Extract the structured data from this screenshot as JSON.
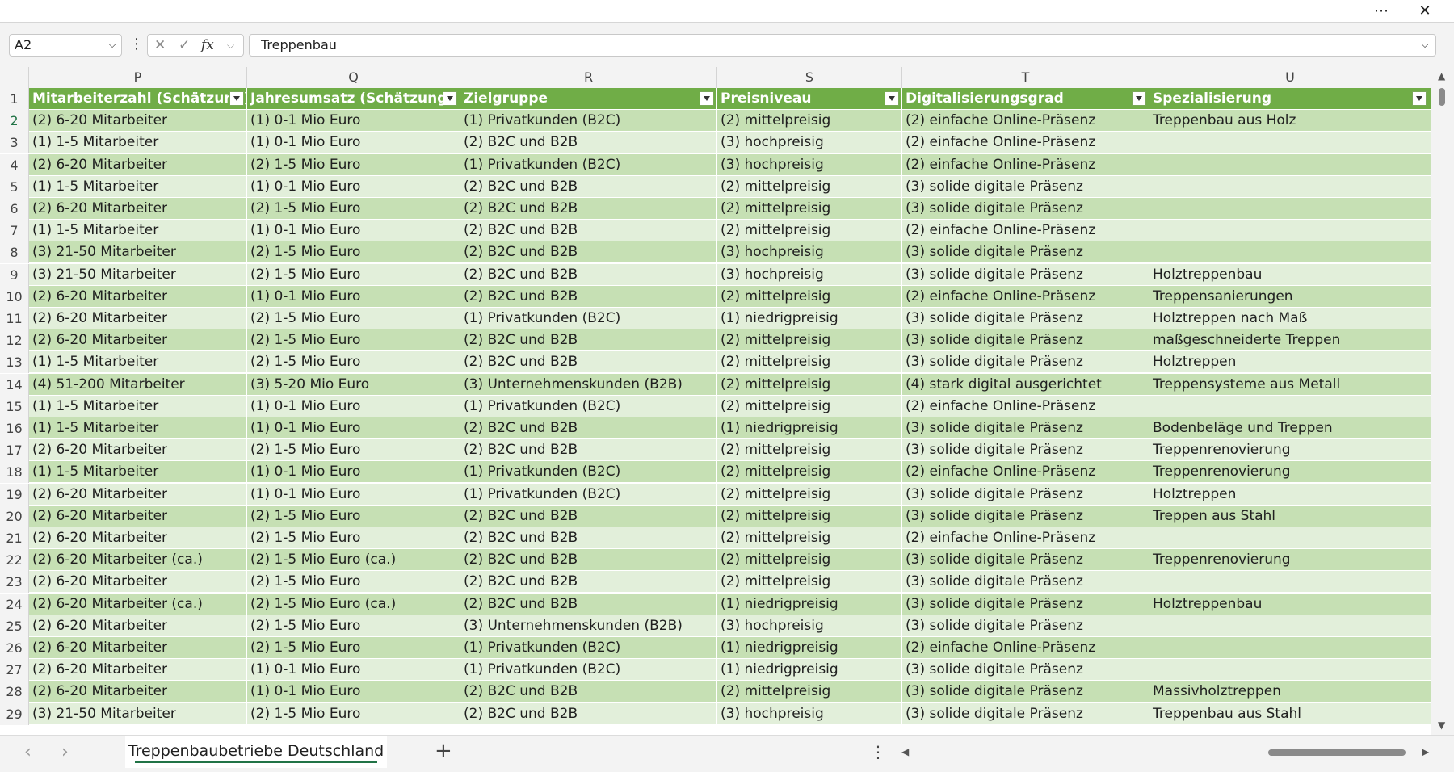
{
  "titlebar": {
    "more_icon": "ellipsis-icon",
    "close_icon": "close-icon"
  },
  "formula_bar": {
    "name_box": "A2",
    "formula": "Treppenbau"
  },
  "columns": [
    {
      "letter": "P",
      "header": "Mitarbeiterzahl (Schätzung)"
    },
    {
      "letter": "Q",
      "header": "Jahresumsatz (Schätzung)"
    },
    {
      "letter": "R",
      "header": "Zielgruppe"
    },
    {
      "letter": "S",
      "header": "Preisniveau"
    },
    {
      "letter": "T",
      "header": "Digitalisierungsgrad"
    },
    {
      "letter": "U",
      "header": "Spezialisierung"
    }
  ],
  "rows": [
    {
      "num": "2",
      "cells": [
        "(2) 6-20 Mitarbeiter",
        "(1) 0-1 Mio Euro",
        "(1) Privatkunden (B2C)",
        "(2) mittelpreisig",
        "(2) einfache Online-Präsenz",
        "Treppenbau aus Holz"
      ]
    },
    {
      "num": "3",
      "cells": [
        "(1) 1-5 Mitarbeiter",
        "(1) 0-1 Mio Euro",
        "(2) B2C und B2B",
        "(3) hochpreisig",
        "(2) einfache Online-Präsenz",
        ""
      ]
    },
    {
      "num": "4",
      "cells": [
        "(2) 6-20 Mitarbeiter",
        "(2) 1-5 Mio Euro",
        "(1) Privatkunden (B2C)",
        "(3) hochpreisig",
        "(2) einfache Online-Präsenz",
        ""
      ]
    },
    {
      "num": "5",
      "cells": [
        "(1) 1-5 Mitarbeiter",
        "(1) 0-1 Mio Euro",
        "(2) B2C und B2B",
        "(2) mittelpreisig",
        "(3) solide digitale Präsenz",
        ""
      ]
    },
    {
      "num": "6",
      "cells": [
        "(2) 6-20 Mitarbeiter",
        "(2) 1-5 Mio Euro",
        "(2) B2C und B2B",
        "(2) mittelpreisig",
        "(3) solide digitale Präsenz",
        ""
      ]
    },
    {
      "num": "7",
      "cells": [
        "(1) 1-5 Mitarbeiter",
        "(1) 0-1 Mio Euro",
        "(2) B2C und B2B",
        "(2) mittelpreisig",
        "(2) einfache Online-Präsenz",
        ""
      ]
    },
    {
      "num": "8",
      "cells": [
        "(3) 21-50 Mitarbeiter",
        "(2) 1-5 Mio Euro",
        "(2) B2C und B2B",
        "(3) hochpreisig",
        "(3) solide digitale Präsenz",
        ""
      ]
    },
    {
      "num": "9",
      "cells": [
        "(3) 21-50 Mitarbeiter",
        "(2) 1-5 Mio Euro",
        "(2) B2C und B2B",
        "(3) hochpreisig",
        "(3) solide digitale Präsenz",
        "Holztreppenbau"
      ]
    },
    {
      "num": "10",
      "cells": [
        "(2) 6-20 Mitarbeiter",
        "(1) 0-1 Mio Euro",
        "(2) B2C und B2B",
        "(2) mittelpreisig",
        "(2) einfache Online-Präsenz",
        "Treppensanierungen"
      ]
    },
    {
      "num": "11",
      "cells": [
        "(2) 6-20 Mitarbeiter",
        "(2) 1-5 Mio Euro",
        "(1) Privatkunden (B2C)",
        "(1) niedrigpreisig",
        "(3) solide digitale Präsenz",
        "Holztreppen nach Maß"
      ]
    },
    {
      "num": "12",
      "cells": [
        "(2) 6-20 Mitarbeiter",
        "(2) 1-5 Mio Euro",
        "(2) B2C und B2B",
        "(2) mittelpreisig",
        "(3) solide digitale Präsenz",
        "maßgeschneiderte Treppen"
      ]
    },
    {
      "num": "13",
      "cells": [
        "(1) 1-5 Mitarbeiter",
        "(2) 1-5 Mio Euro",
        "(2) B2C und B2B",
        "(2) mittelpreisig",
        "(3) solide digitale Präsenz",
        "Holztreppen"
      ]
    },
    {
      "num": "14",
      "cells": [
        "(4) 51-200 Mitarbeiter",
        "(3) 5-20 Mio Euro",
        "(3) Unternehmenskunden (B2B)",
        "(2) mittelpreisig",
        "(4) stark digital ausgerichtet",
        "Treppensysteme aus Metall"
      ]
    },
    {
      "num": "15",
      "cells": [
        "(1) 1-5 Mitarbeiter",
        "(1) 0-1 Mio Euro",
        "(1) Privatkunden (B2C)",
        "(2) mittelpreisig",
        "(2) einfache Online-Präsenz",
        ""
      ]
    },
    {
      "num": "16",
      "cells": [
        "(1) 1-5 Mitarbeiter",
        "(1) 0-1 Mio Euro",
        "(2) B2C und B2B",
        "(1) niedrigpreisig",
        "(3) solide digitale Präsenz",
        "Bodenbeläge und Treppen"
      ]
    },
    {
      "num": "17",
      "cells": [
        "(2) 6-20 Mitarbeiter",
        "(2) 1-5 Mio Euro",
        "(2) B2C und B2B",
        "(2) mittelpreisig",
        "(3) solide digitale Präsenz",
        "Treppenrenovierung"
      ]
    },
    {
      "num": "18",
      "cells": [
        "(1) 1-5 Mitarbeiter",
        "(1) 0-1 Mio Euro",
        "(1) Privatkunden (B2C)",
        "(2) mittelpreisig",
        "(2) einfache Online-Präsenz",
        "Treppenrenovierung"
      ]
    },
    {
      "num": "19",
      "cells": [
        "(2) 6-20 Mitarbeiter",
        "(1) 0-1 Mio Euro",
        "(1) Privatkunden (B2C)",
        "(2) mittelpreisig",
        "(3) solide digitale Präsenz",
        "Holztreppen"
      ]
    },
    {
      "num": "20",
      "cells": [
        "(2) 6-20 Mitarbeiter",
        "(2) 1-5 Mio Euro",
        "(2) B2C und B2B",
        "(2) mittelpreisig",
        "(3) solide digitale Präsenz",
        "Treppen aus Stahl"
      ]
    },
    {
      "num": "21",
      "cells": [
        "(2) 6-20 Mitarbeiter",
        "(2) 1-5 Mio Euro",
        "(2) B2C und B2B",
        "(2) mittelpreisig",
        "(2) einfache Online-Präsenz",
        ""
      ]
    },
    {
      "num": "22",
      "cells": [
        "(2) 6-20 Mitarbeiter (ca.)",
        "(2) 1-5 Mio Euro (ca.)",
        "(2) B2C und B2B",
        "(2) mittelpreisig",
        "(3) solide digitale Präsenz",
        "Treppenrenovierung"
      ]
    },
    {
      "num": "23",
      "cells": [
        "(2) 6-20 Mitarbeiter",
        "(2) 1-5 Mio Euro",
        "(2) B2C und B2B",
        "(2) mittelpreisig",
        "(3) solide digitale Präsenz",
        ""
      ]
    },
    {
      "num": "24",
      "cells": [
        "(2) 6-20 Mitarbeiter (ca.)",
        "(2) 1-5 Mio Euro (ca.)",
        "(2) B2C und B2B",
        "(1) niedrigpreisig",
        "(3) solide digitale Präsenz",
        "Holztreppenbau"
      ]
    },
    {
      "num": "25",
      "cells": [
        "(2) 6-20 Mitarbeiter",
        "(2) 1-5 Mio Euro",
        "(3) Unternehmenskunden (B2B)",
        "(3) hochpreisig",
        "(3) solide digitale Präsenz",
        ""
      ]
    },
    {
      "num": "26",
      "cells": [
        "(2) 6-20 Mitarbeiter",
        "(2) 1-5 Mio Euro",
        "(1) Privatkunden (B2C)",
        "(1) niedrigpreisig",
        "(2) einfache Online-Präsenz",
        ""
      ]
    },
    {
      "num": "27",
      "cells": [
        "(2) 6-20 Mitarbeiter",
        "(1) 0-1 Mio Euro",
        "(1) Privatkunden (B2C)",
        "(1) niedrigpreisig",
        "(3) solide digitale Präsenz",
        ""
      ]
    },
    {
      "num": "28",
      "cells": [
        "(2) 6-20 Mitarbeiter",
        "(1) 0-1 Mio Euro",
        "(2) B2C und B2B",
        "(2) mittelpreisig",
        "(3) solide digitale Präsenz",
        "Massivholztreppen"
      ]
    },
    {
      "num": "29",
      "cells": [
        "(3) 21-50 Mitarbeiter",
        "(2) 1-5 Mio Euro",
        "(2) B2C und B2B",
        "(3) hochpreisig",
        "(3) solide digitale Präsenz",
        "Treppenbau aus Stahl"
      ]
    }
  ],
  "sheet_tab": {
    "label": "Treppenbaubetriebe Deutschland"
  },
  "colors": {
    "header_green": "#70ad47",
    "band_dark": "#c6e0b4",
    "band_light": "#e2efda",
    "accent": "#217346"
  }
}
